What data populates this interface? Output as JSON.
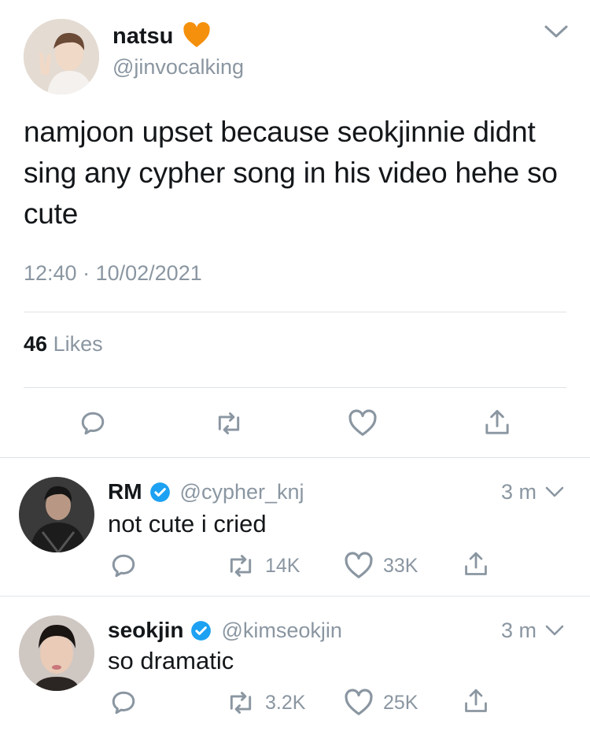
{
  "main_tweet": {
    "display_name": "natsu",
    "badge_icon": "orange-heart",
    "handle": "@jinvocalking",
    "text": "namjoon upset because seokjinnie didnt sing any cypher song in his video hehe so cute",
    "time": "12:40",
    "date": "10/02/2021",
    "likes_count": "46",
    "likes_label": "Likes",
    "actions": [
      "reply-icon",
      "retweet-icon",
      "like-icon",
      "share-icon"
    ]
  },
  "replies": [
    {
      "display_name": "RM",
      "verified": true,
      "handle": "@cypher_knj",
      "time": "3 m",
      "text": "not cute i cried",
      "retweets": "14K",
      "likes": "33K"
    },
    {
      "display_name": "seokjin",
      "verified": true,
      "handle": "@kimseokjin",
      "time": "3 m",
      "text": "so dramatic",
      "retweets": "3.2K",
      "likes": "25K"
    }
  ],
  "colors": {
    "text": "#14171a",
    "secondary": "#8a96a1",
    "verified": "#1da1f2",
    "heart_badge": "#f4900c",
    "divider": "#dfe3e7"
  }
}
